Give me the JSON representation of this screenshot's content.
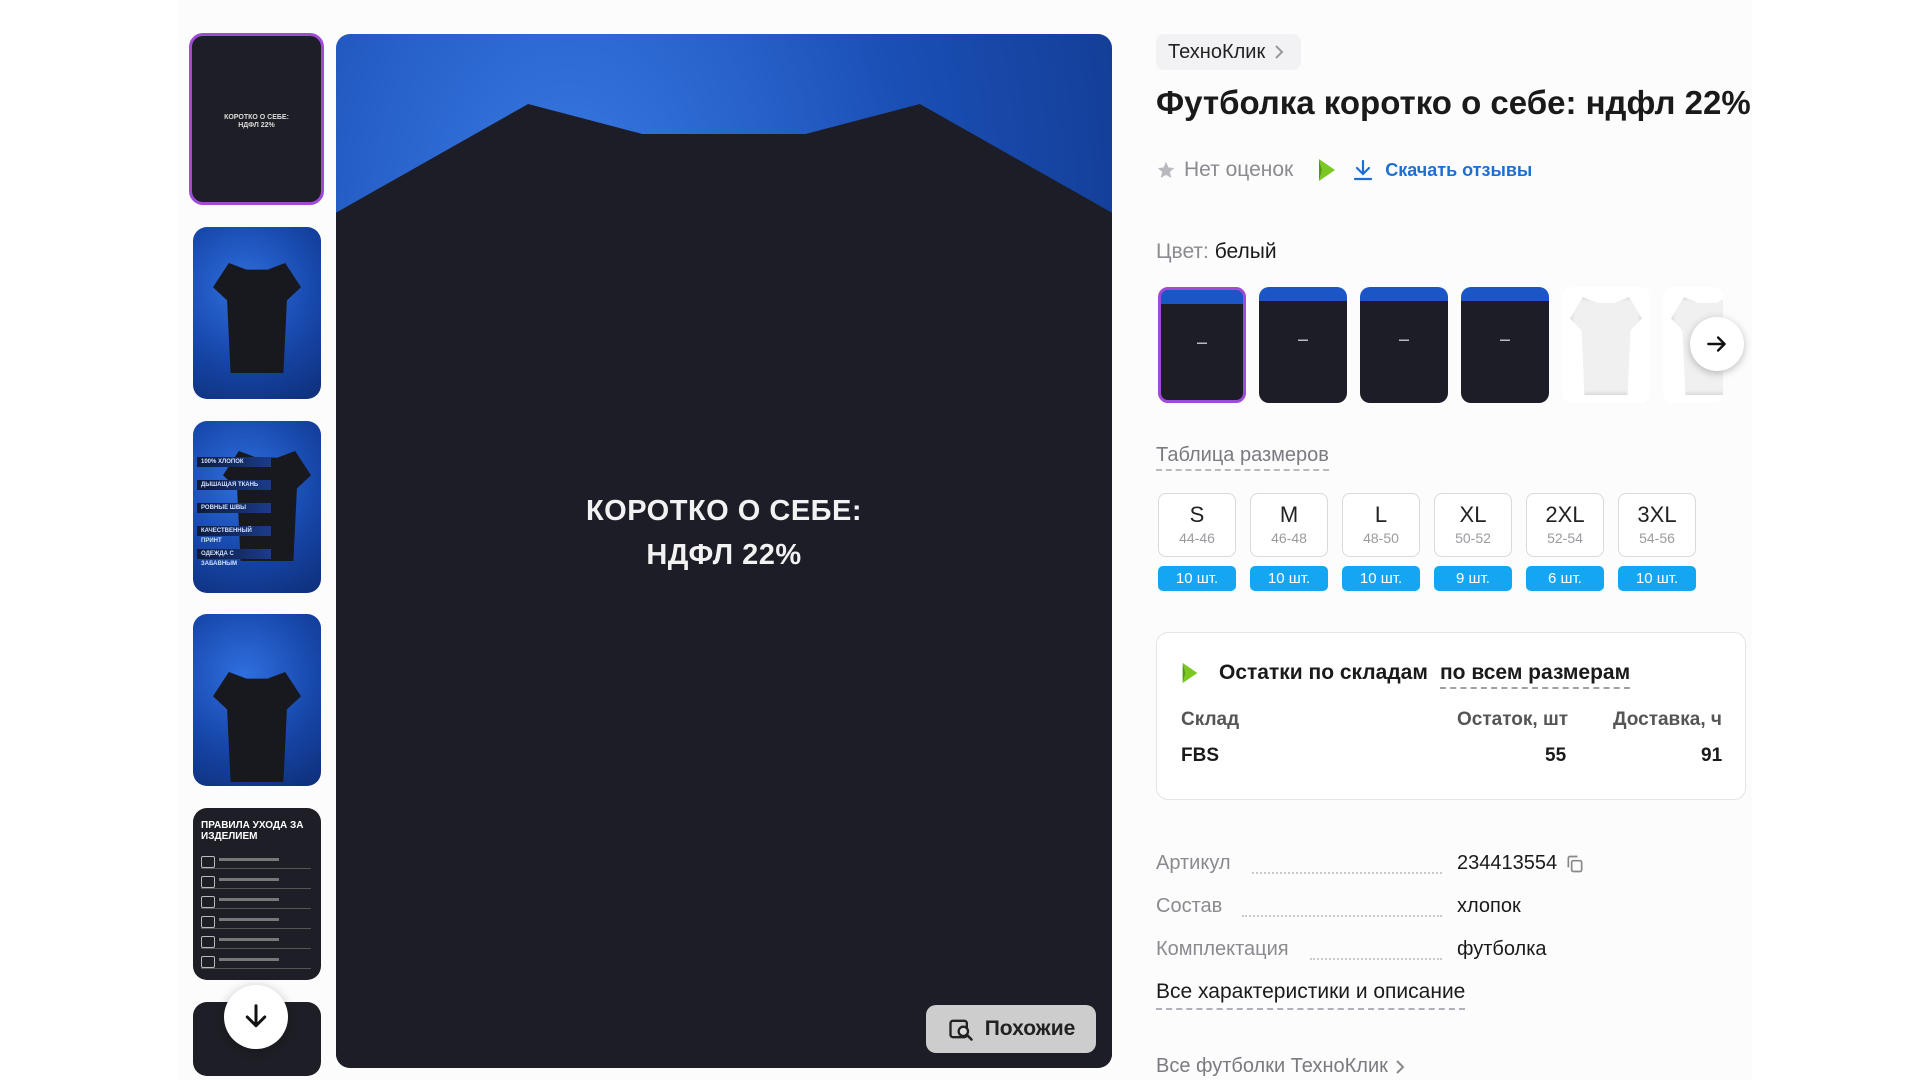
{
  "thumbnails": {
    "thumb1_text": "КОРОТКО О СЕБЕ:\nНДФЛ 22%",
    "thumb3_bars": [
      "100% ХЛОПОК",
      "ДЫШАЩАЯ ТКАНЬ",
      "РОВНЫЕ ШВЫ",
      "КАЧЕСТВЕННЫЙ ПРИНТ",
      "ОДЕЖДА С ЗАБАВНЫМ"
    ],
    "thumb5_title": "ПРАВИЛА УХОДА ЗА ИЗДЕЛИЕМ"
  },
  "main_image": {
    "caption_line1": "КОРОТКО О СЕБЕ:",
    "caption_line2": "НДФЛ 22%",
    "similar_label": "Похожие"
  },
  "product": {
    "brand": "ТехноКлик",
    "title": "Футболка коротко о себе: ндфл 22%",
    "no_ratings": "Нет оценок",
    "download_reviews": "Скачать отзывы",
    "color_label": "Цвет:",
    "color_value": "белый",
    "size_table_link": "Таблица размеров",
    "sizes": [
      {
        "size": "S",
        "range": "44-46",
        "qty": "10 шт."
      },
      {
        "size": "M",
        "range": "46-48",
        "qty": "10 шт."
      },
      {
        "size": "L",
        "range": "48-50",
        "qty": "10 шт."
      },
      {
        "size": "XL",
        "range": "50-52",
        "qty": "9 шт."
      },
      {
        "size": "2XL",
        "range": "52-54",
        "qty": "6 шт."
      },
      {
        "size": "3XL",
        "range": "54-56",
        "qty": "10 шт."
      }
    ]
  },
  "stock": {
    "title": "Остатки по складам",
    "all_sizes_link": "по всем размерам",
    "col_warehouse": "Склад",
    "col_remaining": "Остаток, шт",
    "col_delivery": "Доставка, ч",
    "row_warehouse": "FBS",
    "row_remaining": "55",
    "row_delivery": "91"
  },
  "specs": {
    "article_label": "Артикул",
    "article_value": "234413554",
    "composition_label": "Состав",
    "composition_value": "хлопок",
    "set_label": "Комплектация",
    "set_value": "футболка",
    "all_specs_link": "Все характеристики и описание",
    "all_brand_tees_link": "Все футболки ТехноКлик"
  },
  "colors": {
    "accent_purple": "#a04bd6",
    "qty_blue": "#14a6f3",
    "link_blue": "#1f6fd1",
    "brand_green": "#7bc820"
  }
}
